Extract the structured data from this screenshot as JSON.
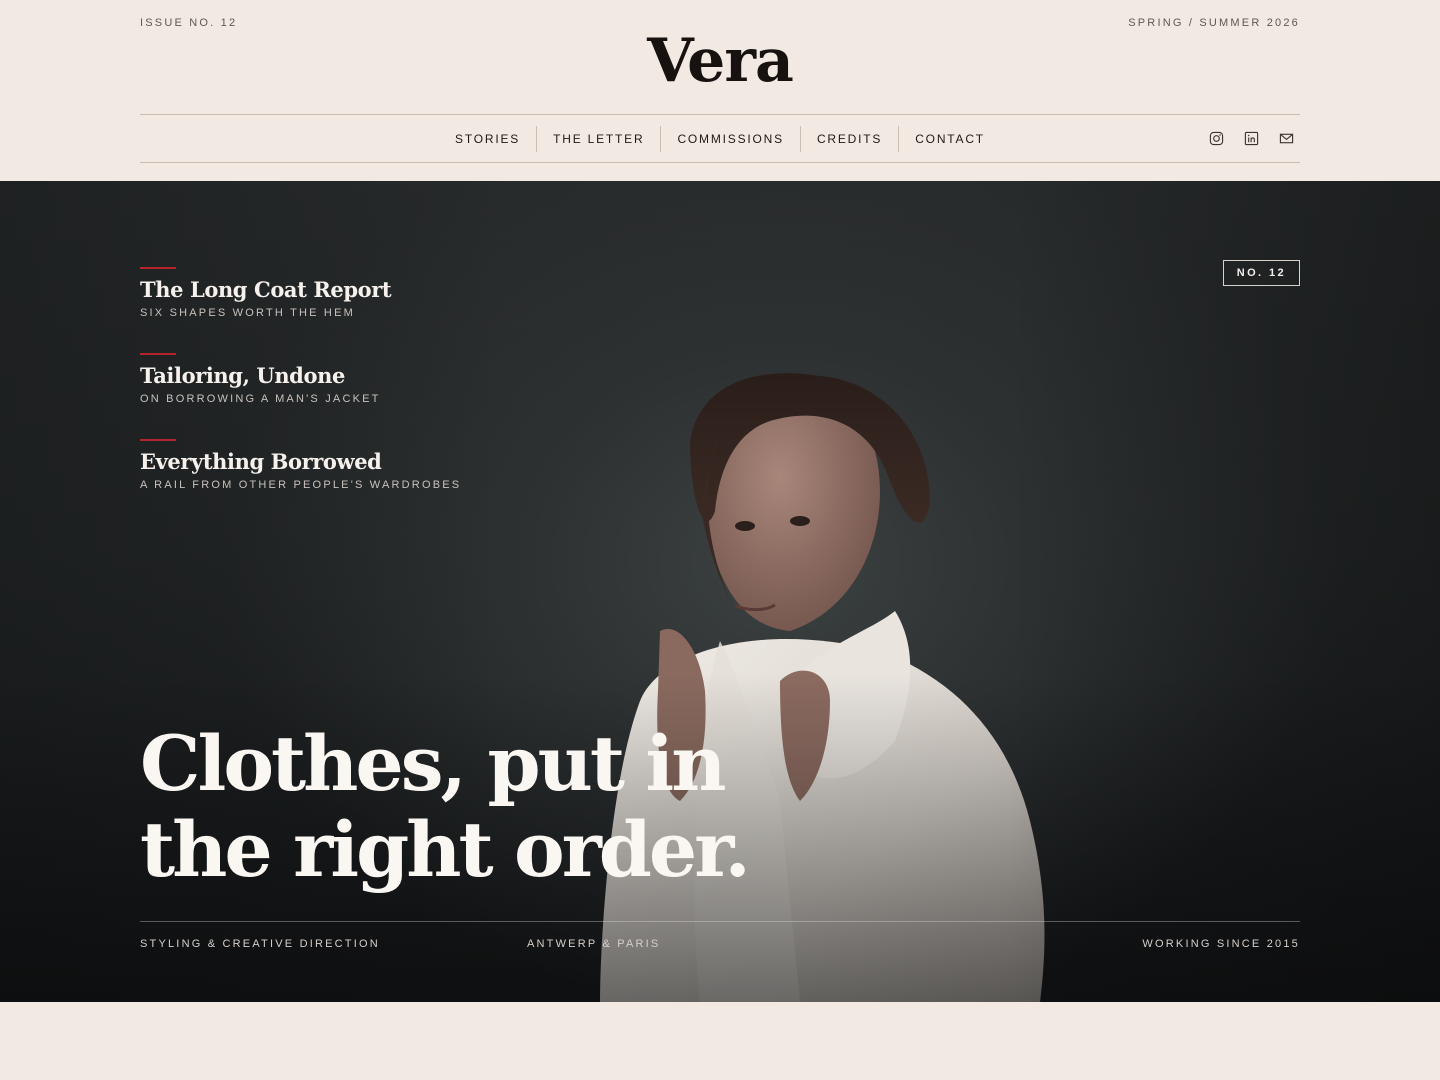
{
  "masthead": {
    "issue_label": "ISSUE NO. 12",
    "season_label": "SPRING / SUMMER 2026",
    "logo": "Vera"
  },
  "nav": {
    "items": [
      {
        "label": "STORIES"
      },
      {
        "label": "THE LETTER"
      },
      {
        "label": "COMMISSIONS"
      },
      {
        "label": "CREDITS"
      },
      {
        "label": "CONTACT"
      }
    ],
    "socials": [
      "instagram-icon",
      "linkedin-icon",
      "mail-icon"
    ]
  },
  "hero": {
    "stories": [
      {
        "title": "The Long Coat Report",
        "subtitle": "SIX SHAPES WORTH THE HEM"
      },
      {
        "title": "Tailoring, Undone",
        "subtitle": "ON BORROWING A MAN'S JACKET"
      },
      {
        "title": "Everything Borrowed",
        "subtitle": "A RAIL FROM OTHER PEOPLE'S WARDROBES"
      }
    ],
    "badge": "NO. 12",
    "headline": [
      "Clothes, put in",
      "the right order."
    ],
    "meta": {
      "left": "STYLING & CREATIVE DIRECTION",
      "center": "ANTWERP & PARIS",
      "right": "WORKING SINCE 2015"
    }
  },
  "colors": {
    "page_bg": "#f2e9e3",
    "hero_bg": "#2a2d2e",
    "accent": "#b5232d",
    "ink": "#17120f"
  }
}
